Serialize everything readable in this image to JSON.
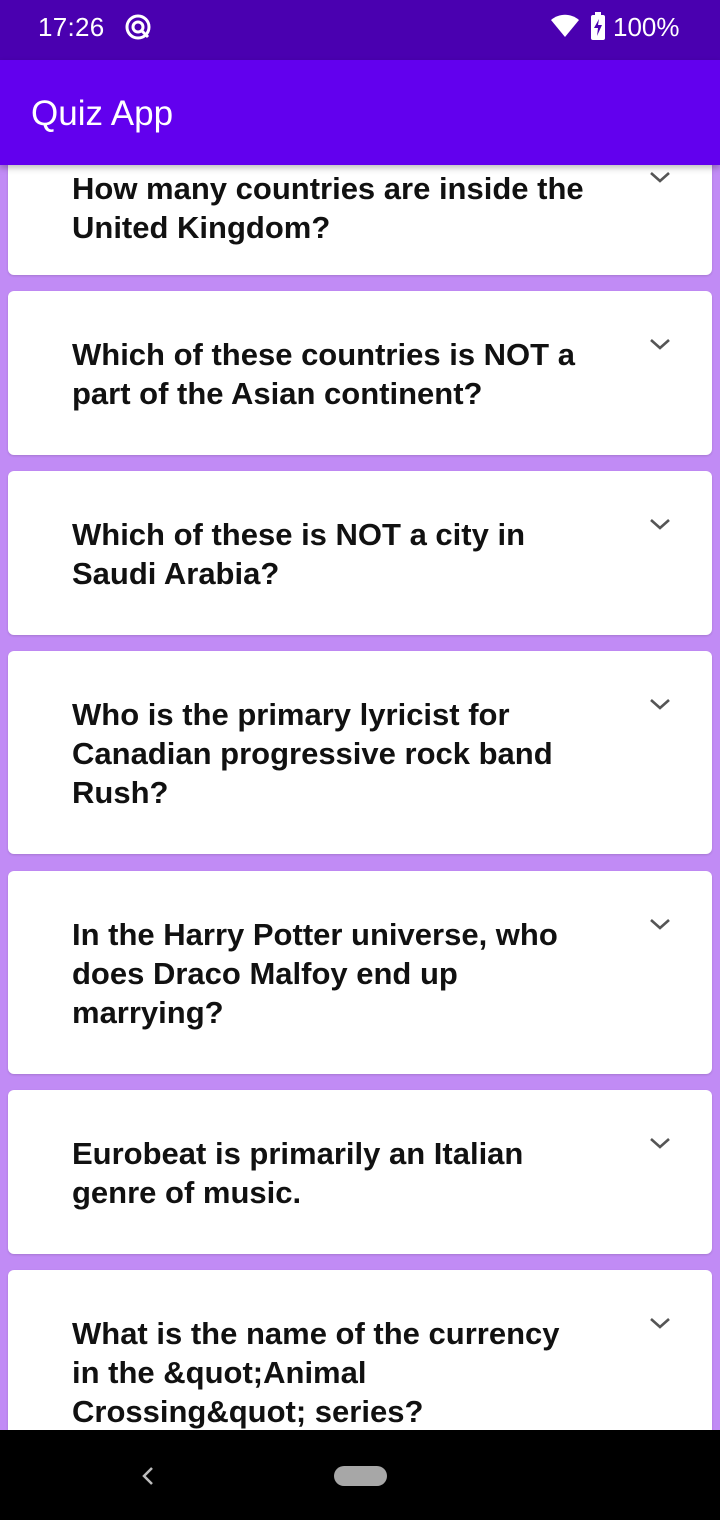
{
  "status_bar": {
    "time": "17:26",
    "app_icon": "quiz-app-status-icon",
    "wifi_icon": "wifi-icon",
    "battery_icon": "battery-charging-icon",
    "battery": "100%"
  },
  "app_bar": {
    "title": "Quiz App",
    "color": "#6200ee"
  },
  "questions": [
    {
      "text": "How many countries are inside the United Kingdom?",
      "expanded": false
    },
    {
      "text": "Which of these countries is NOT a part of the Asian continent?",
      "expanded": false
    },
    {
      "text": "Which of these is NOT a city in Saudi Arabia?",
      "expanded": false
    },
    {
      "text": "Who is the primary lyricist for Canadian progressive rock band Rush?",
      "expanded": false
    },
    {
      "text": "In the Harry Potter universe, who does Draco Malfoy end up marrying?",
      "expanded": false
    },
    {
      "text": "Eurobeat is primarily an Italian genre of music.",
      "expanded": false
    },
    {
      "text": "What is the name of the currency in the &quot;Animal Crossing&quot; series?",
      "expanded": false
    }
  ],
  "colors": {
    "status_bar": "#4a00b0",
    "list_background": "#c18bf5",
    "card": "#ffffff"
  }
}
